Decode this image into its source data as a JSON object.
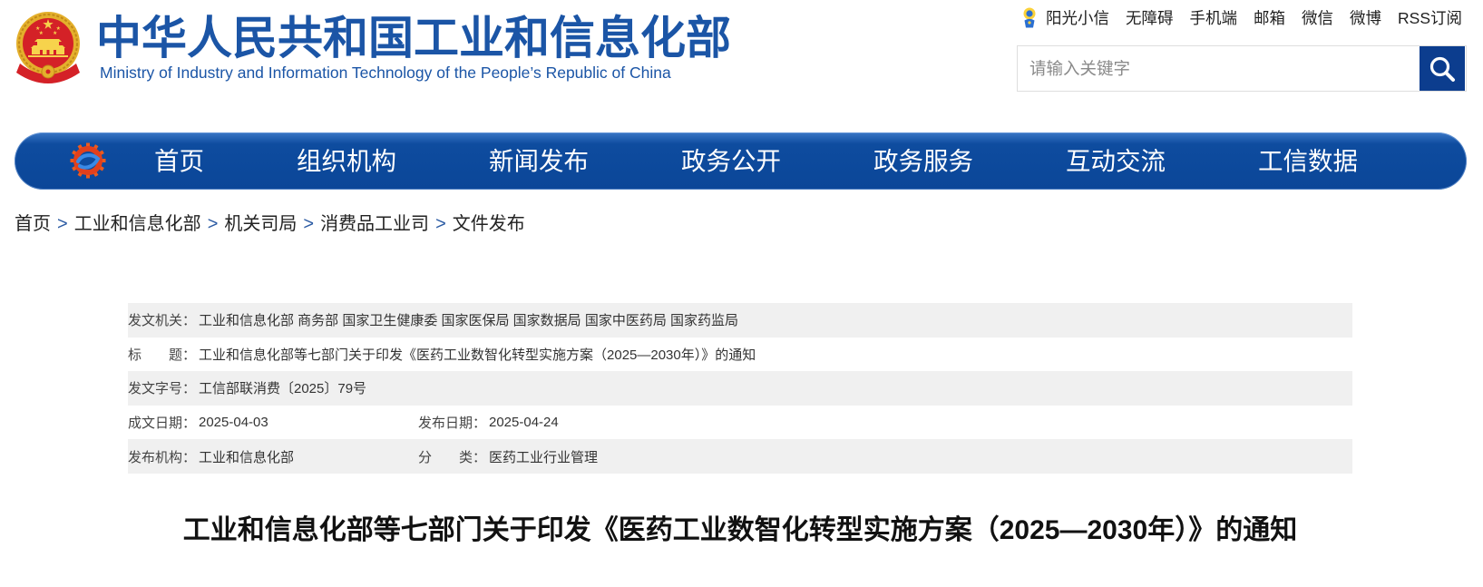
{
  "header": {
    "emblem_icon": "national-emblem-icon",
    "title_cn": "中华人民共和国工业和信息化部",
    "title_en": "Ministry of Industry and Information Technology of the People’s Republic of China"
  },
  "top_links": [
    {
      "label": "阳光小信",
      "icon": "sunshine-mascot-icon"
    },
    {
      "label": "无障碍"
    },
    {
      "label": "手机端"
    },
    {
      "label": "邮箱"
    },
    {
      "label": "微信"
    },
    {
      "label": "微博"
    },
    {
      "label": "RSS订阅"
    }
  ],
  "search": {
    "placeholder": "请输入关键字",
    "value": "",
    "button_icon": "search-icon"
  },
  "nav": {
    "logo_icon": "miit-logo-icon",
    "items": [
      "首页",
      "组织机构",
      "新闻发布",
      "政务公开",
      "政务服务",
      "互动交流",
      "工信数据"
    ]
  },
  "breadcrumb": {
    "separator": ">",
    "items": [
      "首页",
      "工业和信息化部",
      "机关司局",
      "消费品工业司",
      "文件发布"
    ]
  },
  "doc_info": {
    "issuer": {
      "label": "发文机关：",
      "value": "工业和信息化部 商务部 国家卫生健康委 国家医保局 国家数据局 国家中医药局 国家药监局"
    },
    "title": {
      "label": "标　　题：",
      "value": "工业和信息化部等七部门关于印发《医药工业数智化转型实施方案（2025—2030年）》的通知"
    },
    "doc_number": {
      "label": "发文字号：",
      "value": "工信部联消费〔2025〕79号"
    },
    "written_date": {
      "label": "成文日期：",
      "value": "2025-04-03"
    },
    "publish_date": {
      "label": "发布日期：",
      "value": "2025-04-24"
    },
    "publisher": {
      "label": "发布机构：",
      "value": "工业和信息化部"
    },
    "category": {
      "label": "分　　类：",
      "value": "医药工业行业管理"
    }
  },
  "article": {
    "title": "工业和信息化部等七部门关于印发《医药工业数智化转型实施方案（2025—2030年）》的通知"
  },
  "colors": {
    "brand_blue": "#1b55a6",
    "nav_blue": "#0e4c9f",
    "search_button": "#0c3d8e",
    "breadcrumb_separator": "#2a5aa3",
    "row_stripe": "#f0f0f0",
    "emblem_red": "#d42127",
    "emblem_gold": "#e4b02c",
    "logo_orange": "#ea5a1e"
  }
}
